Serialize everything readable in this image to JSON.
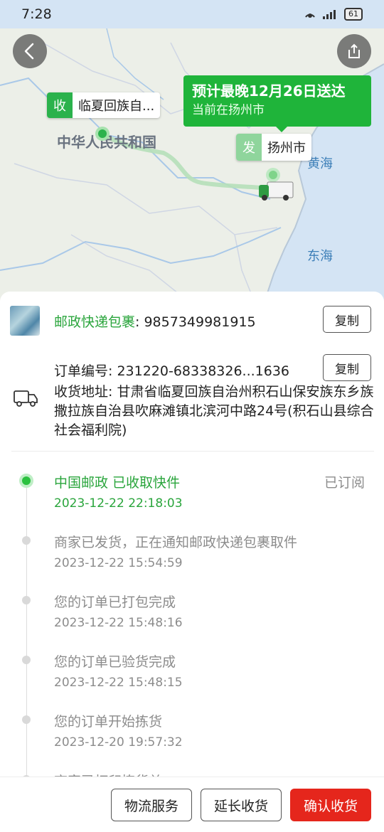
{
  "status_bar": {
    "time": "7:28",
    "battery": "61"
  },
  "map": {
    "country_label": "中华人民共和国",
    "sea_label_1": "黄海",
    "sea_label_2": "东海",
    "receive_tag": {
      "badge": "收",
      "text": "临夏回族自..."
    },
    "send_tag": {
      "badge": "发",
      "text": "扬州市"
    },
    "eta": {
      "title": "预计最晚12月26日送达",
      "subtitle": "当前在扬州市"
    }
  },
  "package": {
    "carrier_label": "邮政快递包裹",
    "separator": ": ",
    "tracking_number": "9857349981915",
    "copy_label": "复制"
  },
  "order": {
    "label": "订单编号: ",
    "number": "231220-68338326...1636",
    "copy_label": "复制"
  },
  "address": {
    "label": "收货地址: ",
    "value": "甘肃省临夏回族自治州积石山保安族东乡族撒拉族自治县吹麻滩镇北滨河中路24号(积石山县综合社会福利院)"
  },
  "timeline": [
    {
      "title": "中国邮政 已收取快件",
      "time": "2023-12-22 22:18:03",
      "subscribed": "已订阅"
    },
    {
      "title": "商家已发货，正在通知邮政快递包裹取件",
      "time": "2023-12-22 15:54:59"
    },
    {
      "title": "您的订单已打包完成",
      "time": "2023-12-22 15:48:16"
    },
    {
      "title": "您的订单已验货完成",
      "time": "2023-12-22 15:48:15"
    },
    {
      "title": "您的订单开始拣货",
      "time": "2023-12-20 19:57:32"
    },
    {
      "title": "商家已打印拣货单",
      "time": ""
    }
  ],
  "bottom_bar": {
    "logistics_service": "物流服务",
    "extend_receipt": "延长收货",
    "confirm_receipt": "确认收货"
  },
  "colors": {
    "accent_green": "#2aa53c",
    "confirm_red": "#e5261c"
  }
}
